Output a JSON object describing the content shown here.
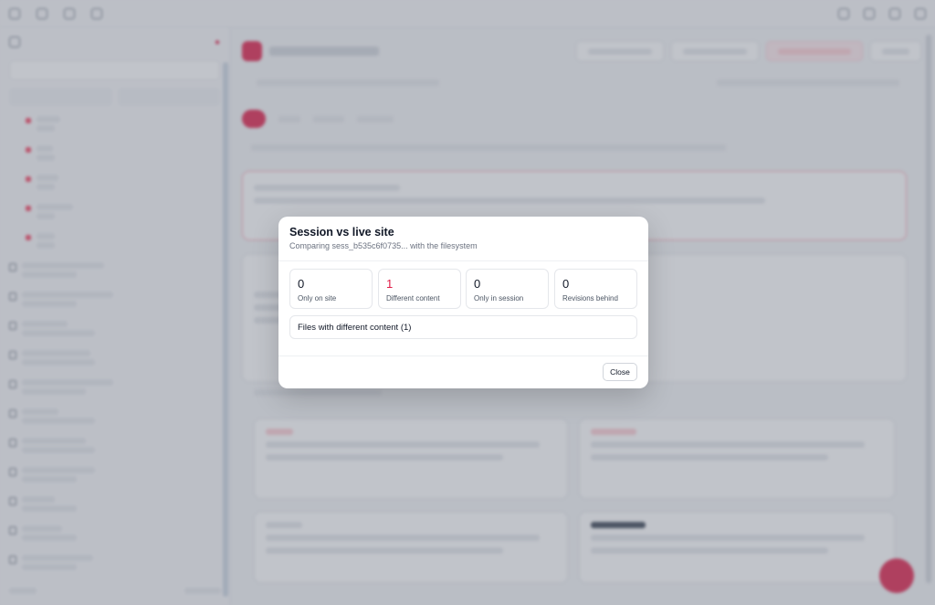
{
  "modal": {
    "title": "Session vs live site",
    "subtitle": "Comparing sess_b535c6f0735... with the filesystem",
    "stats": [
      {
        "value": "0",
        "label": "Only on site"
      },
      {
        "value": "1",
        "label": "Different content"
      },
      {
        "value": "0",
        "label": "Only in session"
      },
      {
        "value": "0",
        "label": "Revisions behind"
      }
    ],
    "files_label": "Files with different content (1)",
    "close_label": "Close"
  },
  "colors": {
    "accent": "#e11d48",
    "overlay": "#6b7280"
  }
}
